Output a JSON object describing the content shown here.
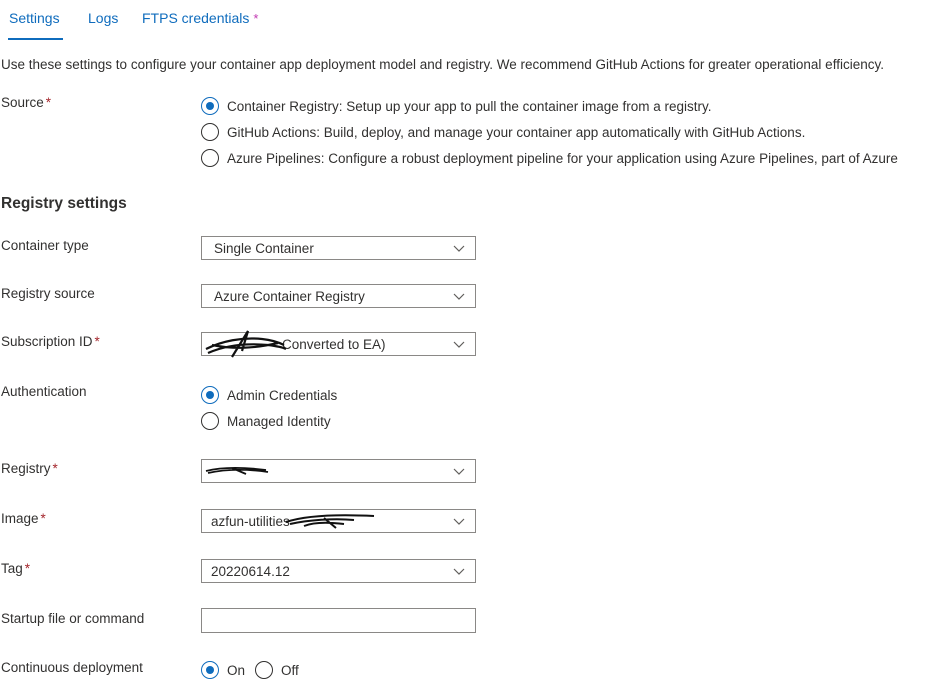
{
  "tabs": [
    {
      "label": "Settings"
    },
    {
      "label": "Logs"
    },
    {
      "label": "FTPS credentials",
      "dirty_marker": "*"
    }
  ],
  "intro": "Use these settings to configure your container app deployment model and registry. We recommend GitHub Actions for greater operational efficiency.",
  "required_marker": "*",
  "source": {
    "label": "Source",
    "options": [
      {
        "label": "Container Registry: Setup up your app to pull the container image from a registry.",
        "selected": true
      },
      {
        "label": "GitHub Actions: Build, deploy, and manage your container app automatically with GitHub Actions.",
        "selected": false
      },
      {
        "label": "Azure Pipelines: Configure a robust deployment pipeline for your application using Azure Pipelines, part of Azure",
        "selected": false
      }
    ]
  },
  "registry_settings": {
    "title": "Registry settings",
    "container_type": {
      "label": "Container type",
      "value": "Single Container"
    },
    "registry_source": {
      "label": "Registry source",
      "value": "Azure Container Registry"
    },
    "subscription": {
      "label": "Subscription ID",
      "value": "Converted to EA)"
    },
    "authentication": {
      "label": "Authentication",
      "options": [
        {
          "label": "Admin Credentials",
          "selected": true
        },
        {
          "label": "Managed Identity",
          "selected": false
        }
      ]
    },
    "registry": {
      "label": "Registry",
      "value": ""
    },
    "image": {
      "label": "Image",
      "value": "azfun-utilities"
    },
    "tag": {
      "label": "Tag",
      "value": "20220614.12"
    },
    "startup": {
      "label": "Startup file or command",
      "value": ""
    },
    "continuous_deployment": {
      "label": "Continuous deployment",
      "options": [
        {
          "label": "On",
          "selected": true
        },
        {
          "label": "Off",
          "selected": false
        }
      ]
    }
  },
  "colors": {
    "accent": "#0f6cbd",
    "required": "#a4262c",
    "dirty": "#c239b3",
    "text": "#323130",
    "border": "#8a8886"
  }
}
